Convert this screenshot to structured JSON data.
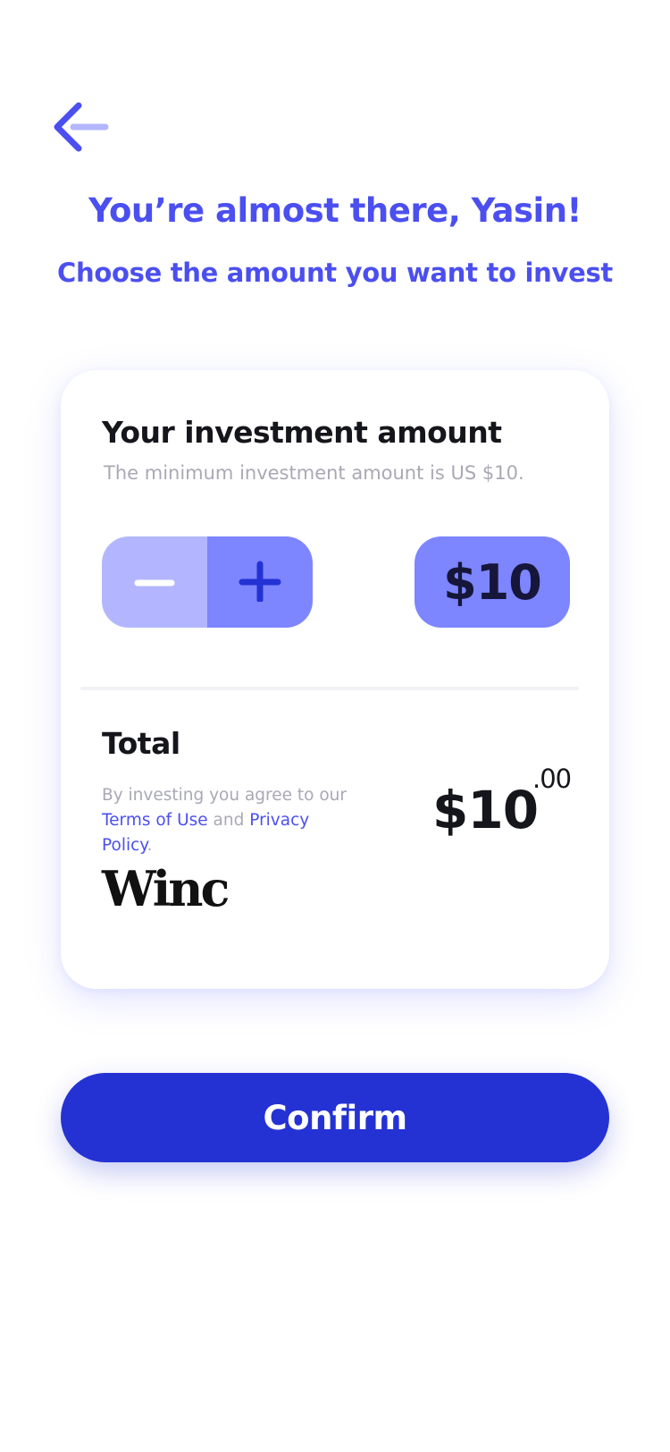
{
  "header": {
    "back_icon": "arrow-left-icon",
    "greeting": "You’re almost there, Yasin!",
    "subtitle": "Choose the amount you want to invest"
  },
  "investment_card": {
    "title": "Your investment amount",
    "hint": "The minimum investment amount is US $10.",
    "stepper": {
      "minus_icon": "minus-icon",
      "plus_icon": "plus-icon"
    },
    "amount_display": "$10",
    "total_label": "Total",
    "agreement": {
      "prefix": "By investing you agree to our",
      "terms_link": "Terms of Use",
      "conjunction": "and",
      "privacy_link": "Privacy Policy",
      "suffix": "."
    },
    "total_amount": "$10",
    "total_cents": ".00",
    "brand_logo": "Winc"
  },
  "actions": {
    "confirm_label": "Confirm"
  },
  "colors": {
    "accent": "#4b4ff0",
    "stepper_light": "#b3b6ff",
    "stepper_mid": "#7d85ff",
    "primary_button": "#2432d4",
    "muted_text": "#a9a9b6"
  }
}
